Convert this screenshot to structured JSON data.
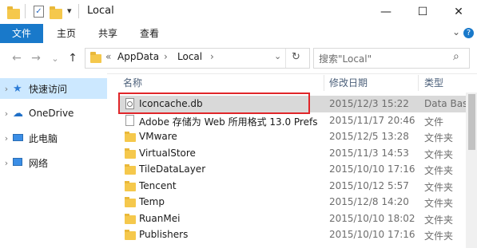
{
  "window": {
    "title": "Local",
    "quick_access_overflow": "▾",
    "controls": {
      "minimize": "—",
      "maximize": "☐",
      "close": "✕"
    }
  },
  "ribbon": {
    "tabs": [
      {
        "label": "文件"
      },
      {
        "label": "主页"
      },
      {
        "label": "共享"
      },
      {
        "label": "查看"
      }
    ],
    "expand_glyph": "⌄",
    "help_glyph": "?"
  },
  "nav": {
    "back": "←",
    "forward": "→",
    "recent": "⌄",
    "up": "↑",
    "breadcrumb": {
      "overflow": "«",
      "items": [
        "AppData",
        "Local"
      ],
      "separator": "›"
    },
    "address_dropdown": "⌄",
    "refresh": "↻",
    "search_placeholder": "搜索\"Local\"",
    "search_icon": "⌕"
  },
  "sidebar": {
    "items": [
      {
        "label": "快速访问",
        "icon": "star-icon",
        "selected": true
      },
      {
        "label": "OneDrive",
        "icon": "cloud-icon",
        "selected": false
      },
      {
        "label": "此电脑",
        "icon": "computer-icon",
        "selected": false
      },
      {
        "label": "网络",
        "icon": "network-icon",
        "selected": false
      }
    ]
  },
  "list": {
    "columns": {
      "name": "名称",
      "date": "修改日期",
      "type": "类型"
    },
    "rows": [
      {
        "name": "Iconcache.db",
        "date": "2015/12/3 15:22",
        "type": "Data Base",
        "icon": "database-file-icon",
        "highlighted": true
      },
      {
        "name": "Adobe 存储为 Web 所用格式 13.0 Prefs",
        "date": "2015/11/17 20:46",
        "type": "文件",
        "icon": "file-icon",
        "highlighted": false
      },
      {
        "name": "VMware",
        "date": "2015/12/5 13:28",
        "type": "文件夹",
        "icon": "folder-icon",
        "highlighted": false
      },
      {
        "name": "VirtualStore",
        "date": "2015/11/3 14:53",
        "type": "文件夹",
        "icon": "folder-icon",
        "highlighted": false
      },
      {
        "name": "TileDataLayer",
        "date": "2015/10/10 17:16",
        "type": "文件夹",
        "icon": "folder-icon",
        "highlighted": false
      },
      {
        "name": "Tencent",
        "date": "2015/10/12 5:57",
        "type": "文件夹",
        "icon": "folder-icon",
        "highlighted": false
      },
      {
        "name": "Temp",
        "date": "2015/12/8 14:20",
        "type": "文件夹",
        "icon": "folder-icon",
        "highlighted": false
      },
      {
        "name": "RuanMei",
        "date": "2015/10/10 18:02",
        "type": "文件夹",
        "icon": "folder-icon",
        "highlighted": false
      },
      {
        "name": "Publishers",
        "date": "2015/10/10 17:16",
        "type": "文件夹",
        "icon": "folder-icon",
        "highlighted": false
      }
    ]
  },
  "colors": {
    "accent": "#1979ca",
    "selection": "#cce8ff",
    "highlight_border": "#e0262a",
    "highlight_row": "#d9d9d9",
    "folder": "#f5c84c"
  }
}
